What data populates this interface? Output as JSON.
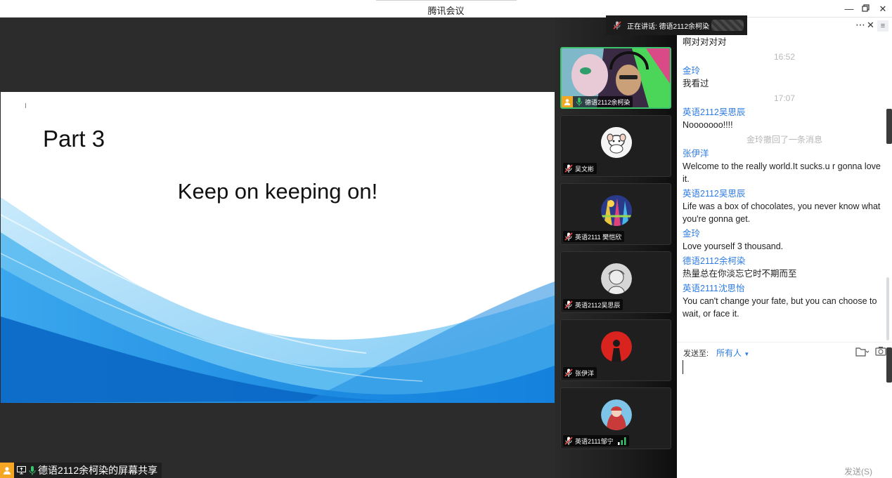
{
  "window": {
    "title": "腾讯会议"
  },
  "slide": {
    "part": "Part 3",
    "headline": "Keep on keeping on!"
  },
  "share_bar": {
    "label": "德语2112余柯染的屏幕共享"
  },
  "speaking": {
    "label": "正在讲话: 德语2112余柯染"
  },
  "participants": [
    {
      "name": "德语2112余柯染",
      "active": true
    },
    {
      "name": "吴文彬"
    },
    {
      "name": "英语2111 樊恺欣"
    },
    {
      "name": "英语2112吴思辰"
    },
    {
      "name": "张伊洋"
    },
    {
      "name": "英语2111邹宁"
    }
  ],
  "chat": {
    "messages": [
      {
        "kind": "body",
        "text": "啊对对对对"
      },
      {
        "kind": "time",
        "text": "16:52"
      },
      {
        "kind": "name",
        "text": "金玲"
      },
      {
        "kind": "body",
        "text": "我看过"
      },
      {
        "kind": "time",
        "text": "17:07"
      },
      {
        "kind": "name",
        "text": "英语2112吴思辰"
      },
      {
        "kind": "body",
        "text": "Nooooooo!!!!"
      },
      {
        "kind": "sys",
        "text": "金玲撤回了一条消息"
      },
      {
        "kind": "name",
        "text": "张伊洋"
      },
      {
        "kind": "body",
        "text": "Welcome to the really world.It sucks.u r gonna love it."
      },
      {
        "kind": "name",
        "text": "英语2112吴思辰"
      },
      {
        "kind": "body",
        "text": "Life was a box of chocolates, you never know what you're gonna get."
      },
      {
        "kind": "name",
        "text": "金玲"
      },
      {
        "kind": "body",
        "text": "Love yourself 3 thousand."
      },
      {
        "kind": "name",
        "text": "德语2112余柯染"
      },
      {
        "kind": "body",
        "text": "热量总在你淡忘它时不期而至"
      },
      {
        "kind": "name",
        "text": "英语2111沈思怡"
      },
      {
        "kind": "body",
        "text": "You can't change your fate, but you can choose to wait, or face it."
      }
    ],
    "send_to_label": "发送至:",
    "recipient": "所有人",
    "send_button": "发送(S)"
  },
  "colors": {
    "accent": "#2d7be0",
    "active_border": "#3cc46d",
    "mic_green": "#3cc46d",
    "user_orange": "#f5a623"
  }
}
